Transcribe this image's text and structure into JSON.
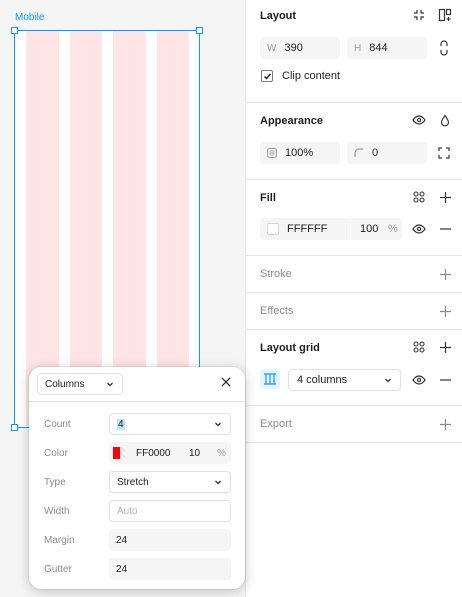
{
  "canvas": {
    "frame_label": "Mobile",
    "grid_columns": 4,
    "grid_color": "#FF0000",
    "grid_opacity_percent": 10
  },
  "panel": {
    "layout": {
      "title": "Layout",
      "width_label": "W",
      "width_value": "390",
      "height_label": "H",
      "height_value": "844",
      "clip_content_label": "Clip content",
      "clip_content_checked": true
    },
    "appearance": {
      "title": "Appearance",
      "opacity_value": "100%",
      "radius_value": "0"
    },
    "fill": {
      "title": "Fill",
      "hex": "FFFFFF",
      "opacity": "100",
      "unit": "%",
      "swatch_color": "#FFFFFF"
    },
    "stroke": {
      "title": "Stroke"
    },
    "effects": {
      "title": "Effects"
    },
    "layout_grid": {
      "title": "Layout grid",
      "selected": "4 columns"
    },
    "export": {
      "title": "Export"
    }
  },
  "popup": {
    "type_select": "Columns",
    "rows": {
      "count_label": "Count",
      "count_value": "4",
      "color_label": "Color",
      "color_hex": "FF0000",
      "color_opacity": "10",
      "color_unit": "%",
      "type_label": "Type",
      "type_value": "Stretch",
      "width_label": "Width",
      "width_placeholder": "Auto",
      "margin_label": "Margin",
      "margin_value": "24",
      "gutter_label": "Gutter",
      "gutter_value": "24"
    }
  }
}
